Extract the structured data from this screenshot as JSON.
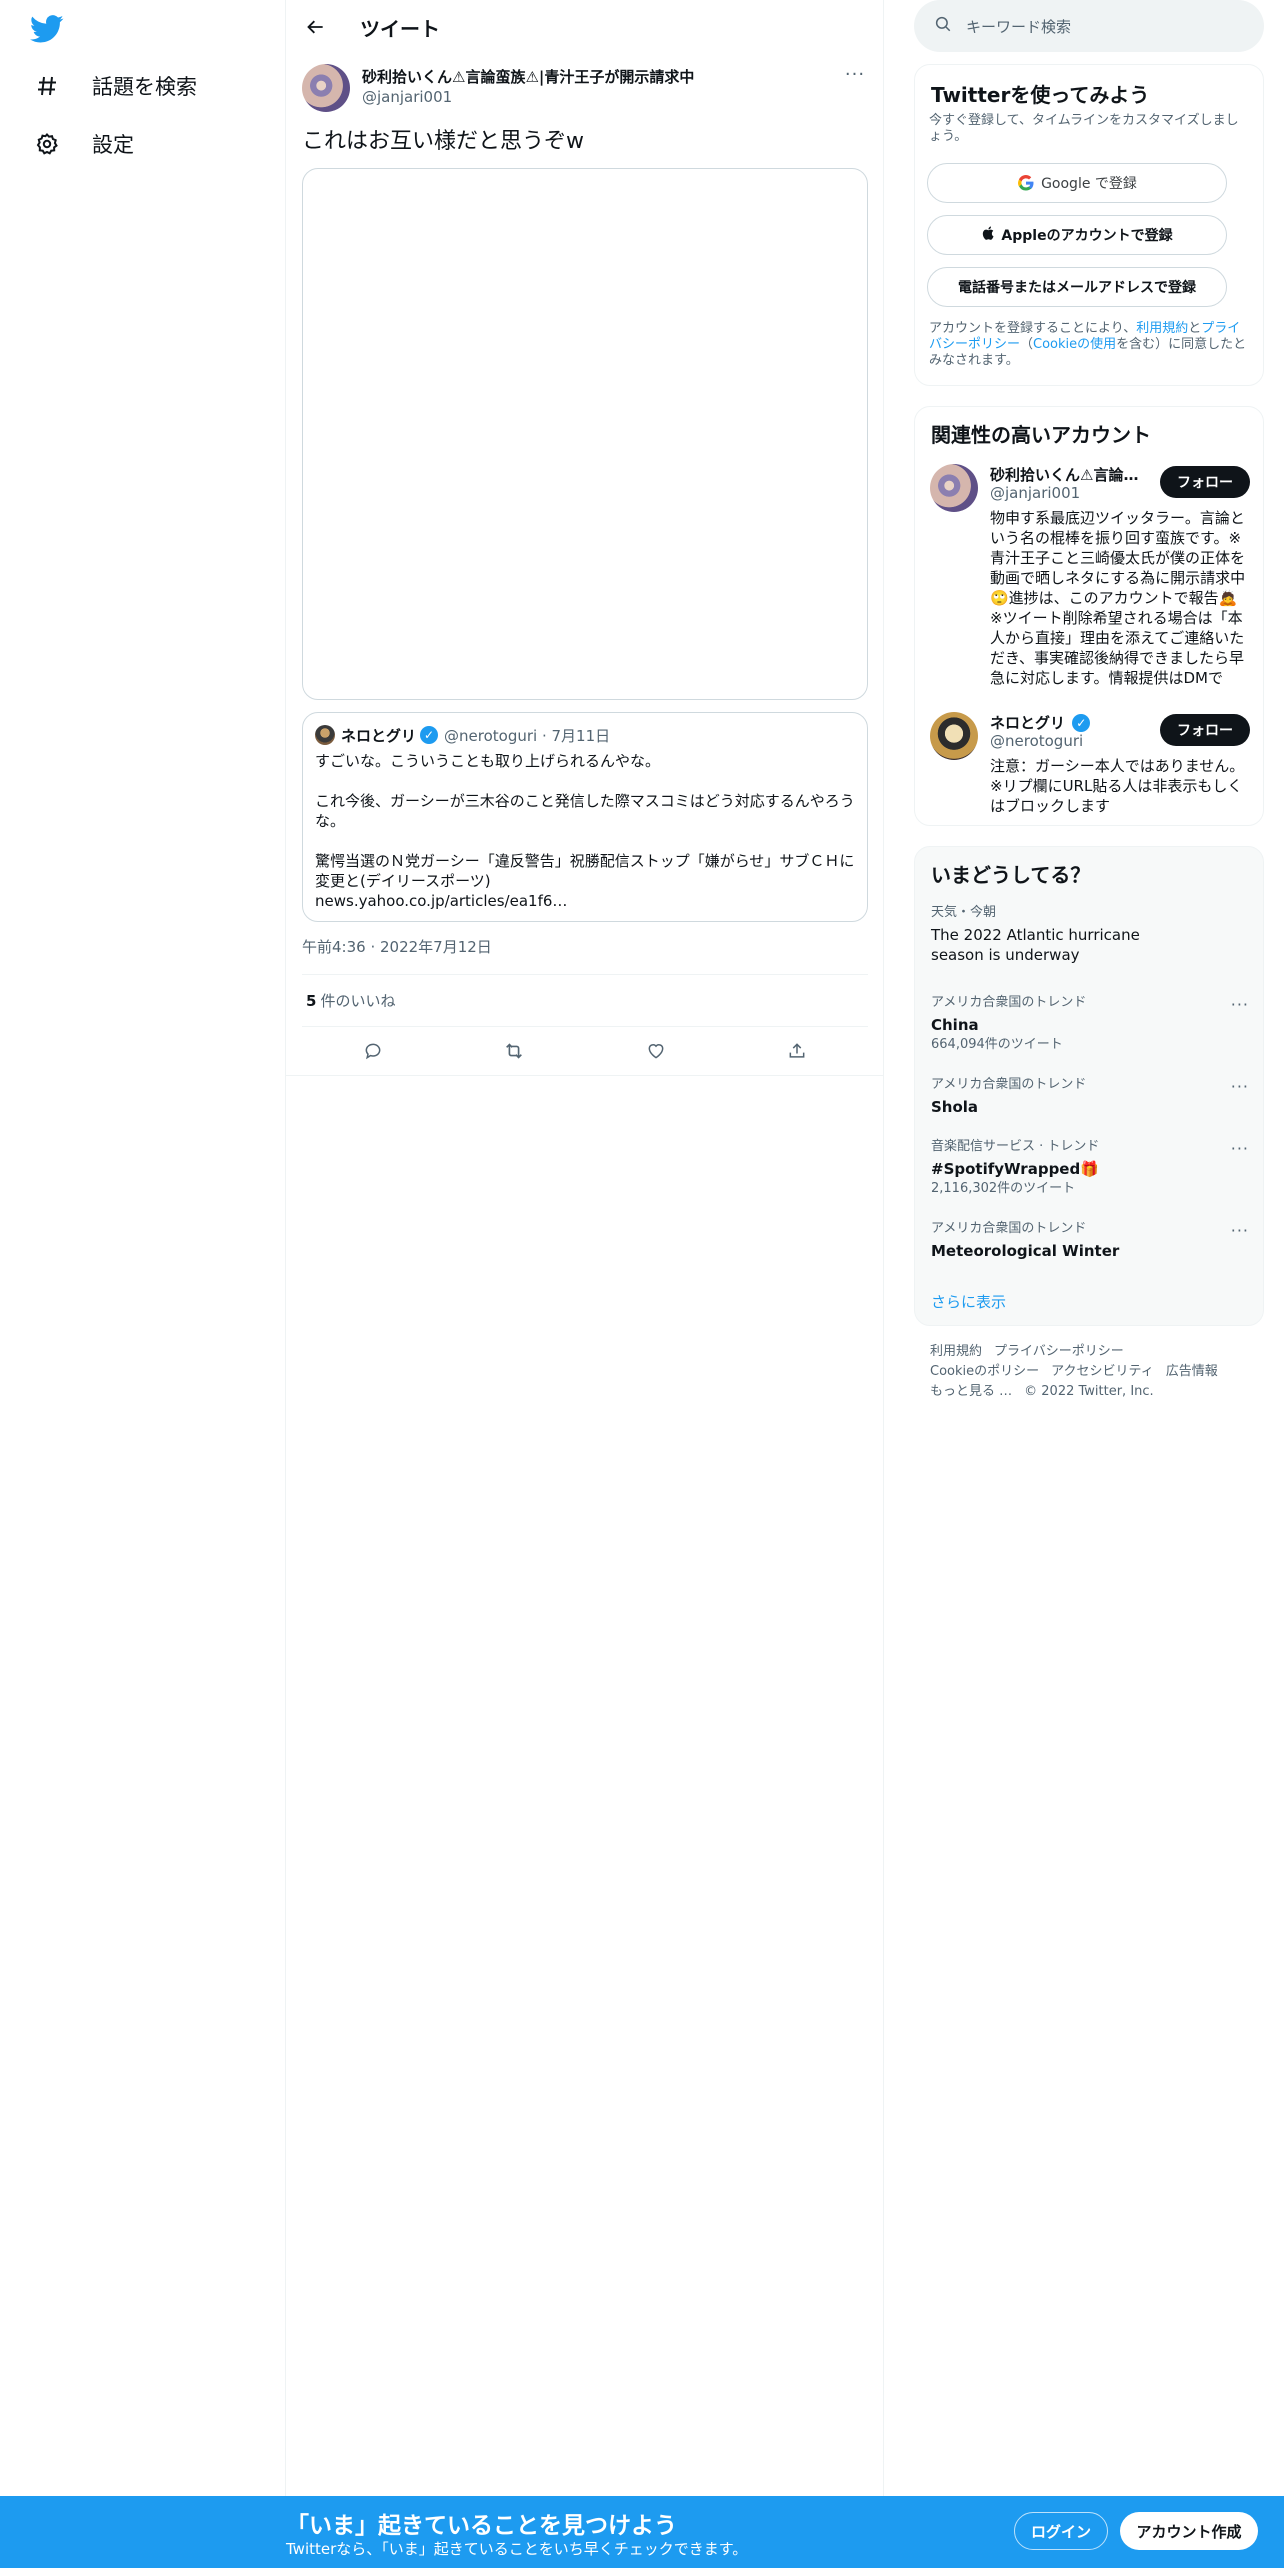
{
  "nav": {
    "logo_icon": "twitter-bird-icon",
    "items": [
      {
        "icon": "hashtag-icon",
        "label": "話題を検索"
      },
      {
        "icon": "gear-icon",
        "label": "設定"
      }
    ]
  },
  "header": {
    "back_icon": "arrow-left-icon",
    "title": "ツイート"
  },
  "tweet": {
    "author_name": "砂利拾いくん⚠言論蛮族⚠|青汁王子が開示請求中",
    "author_handle": "@janjari001",
    "text": "これはお互い様だと思うぞw",
    "quote": {
      "name": "ネロとグリ",
      "verified_icon": "verified-badge-icon",
      "handle_date": "@nerotoguri · 7月11日",
      "body": "すごいな。こういうことも取り上げられるんやな。\n\nこれ今後、ガーシーが三木谷のこと発信した際マスコミはどう対応するんやろうな。\n\n驚愕当選のＮ党ガーシー「違反警告」祝勝配信ストップ「嫌がらせ」サブＣＨに変更と(デイリースポーツ)\nnews.yahoo.co.jp/articles/ea1f6…"
    },
    "timestamp": "午前4:36 · 2022年7月12日",
    "likes_count": "5",
    "likes_label": "件のいいね",
    "actions": [
      "reply-icon",
      "retweet-icon",
      "like-icon",
      "share-icon"
    ]
  },
  "search": {
    "placeholder": "キーワード検索",
    "icon": "search-icon"
  },
  "signup": {
    "title": "Twitterを使ってみよう",
    "subtitle": "今すぐ登録して、タイムラインをカスタマイズしましょう。",
    "google_label": "Google で登録",
    "apple_label": "Appleのアカウントで登録",
    "phone_label": "電話番号またはメールアドレスで登録",
    "terms_prefix": "アカウントを登録することにより、",
    "terms_link": "利用規約",
    "terms_and": "と",
    "privacy_link": "プライバシーポリシー",
    "terms_paren_open": "（",
    "cookie_link": "Cookieの使用",
    "terms_suffix": "を含む）に同意したとみなされます。"
  },
  "related": {
    "title": "関連性の高いアカウント",
    "accounts": [
      {
        "name": "砂利拾いくん⚠言論蛮族⚠|青汁王子が開示請求中",
        "handle": "@janjari001",
        "follow": "フォロー",
        "bio": "物申す系最底辺ツイッタラー。言論という名の棍棒を振り回す蛮族です。※青汁王子こと三崎優太氏が僕の正体を動画で晒しネタにする為に開示請求中🙄進捗は、このアカウントで報告🙇※ツイート削除希望される場合は「本人から直接」理由を添えてご連絡いただき、事実確認後納得できましたら早急に対応します。情報提供はDMで"
      },
      {
        "name": "ネロとグリ",
        "handle": "@nerotoguri",
        "follow": "フォロー",
        "bio": "注意：ガーシー本人ではありません。※リプ欄にURL貼る人は非表示もしくはブロックします"
      }
    ]
  },
  "trends": {
    "title": "いまどうしてる？",
    "items": [
      {
        "context": "天気・今朝",
        "name": "The 2022 Atlantic hurricane season is underway",
        "count": ""
      },
      {
        "context": "アメリカ合衆国のトレンド",
        "name": "China",
        "count": "664,094件のツイート"
      },
      {
        "context": "アメリカ合衆国のトレンド",
        "name": "Shola",
        "count": ""
      },
      {
        "context": "音楽配信サービス · トレンド",
        "name": "#SpotifyWrapped🎁",
        "count": "2,116,302件のツイート"
      },
      {
        "context": "アメリカ合衆国のトレンド",
        "name": "Meteorological Winter",
        "count": ""
      }
    ],
    "show_more": "さらに表示"
  },
  "footer": {
    "links": [
      "利用規約",
      "プライバシーポリシー",
      "Cookieのポリシー",
      "アクセシビリティ",
      "広告情報",
      "もっと見る …",
      "© 2022 Twitter, Inc."
    ]
  },
  "bottom_bar": {
    "title": "「いま」起きていることを見つけよう",
    "subtitle": "Twitterなら、「いま」起きていることをいち早くチェックできます。",
    "login": "ログイン",
    "signup": "アカウント作成"
  },
  "colors": {
    "accent": "#1d9bf0",
    "text": "#0f1419",
    "muted": "#536471",
    "border": "#cfd9de"
  }
}
